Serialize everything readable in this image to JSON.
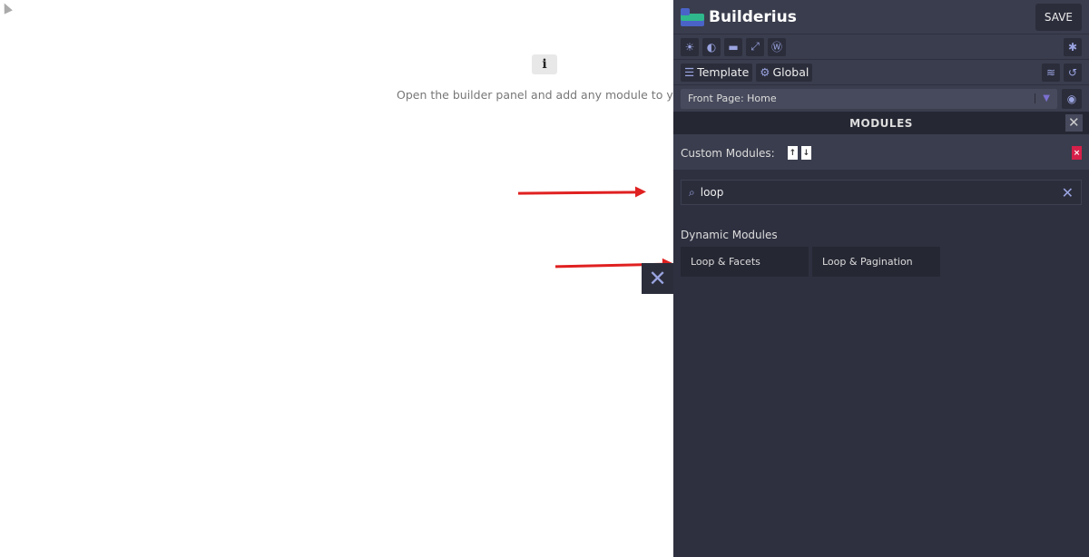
{
  "canvas": {
    "info_icon": "i",
    "hint": "Open the builder panel and add any module to your canvas"
  },
  "panel": {
    "brand": "Builderius",
    "save_label": "SAVE",
    "toolbar_icons": [
      "sun-icon",
      "contrast-icon",
      "align-right-icon",
      "expand-icon",
      "wordpress-icon"
    ],
    "debug_icon": "bug-icon",
    "tabs": [
      {
        "label": "Template",
        "icon": "table-icon"
      },
      {
        "label": "Global",
        "icon": "cogs-icon"
      }
    ],
    "page_select": "Front Page: Home",
    "modules_title": "MODULES",
    "custom_modules_label": "Custom Modules:",
    "search_value": "loop",
    "category": "Dynamic Modules",
    "modules": [
      "Loop & Facets",
      "Loop & Pagination"
    ],
    "accent": "#9aa4e0",
    "danger": "#d6204a"
  }
}
